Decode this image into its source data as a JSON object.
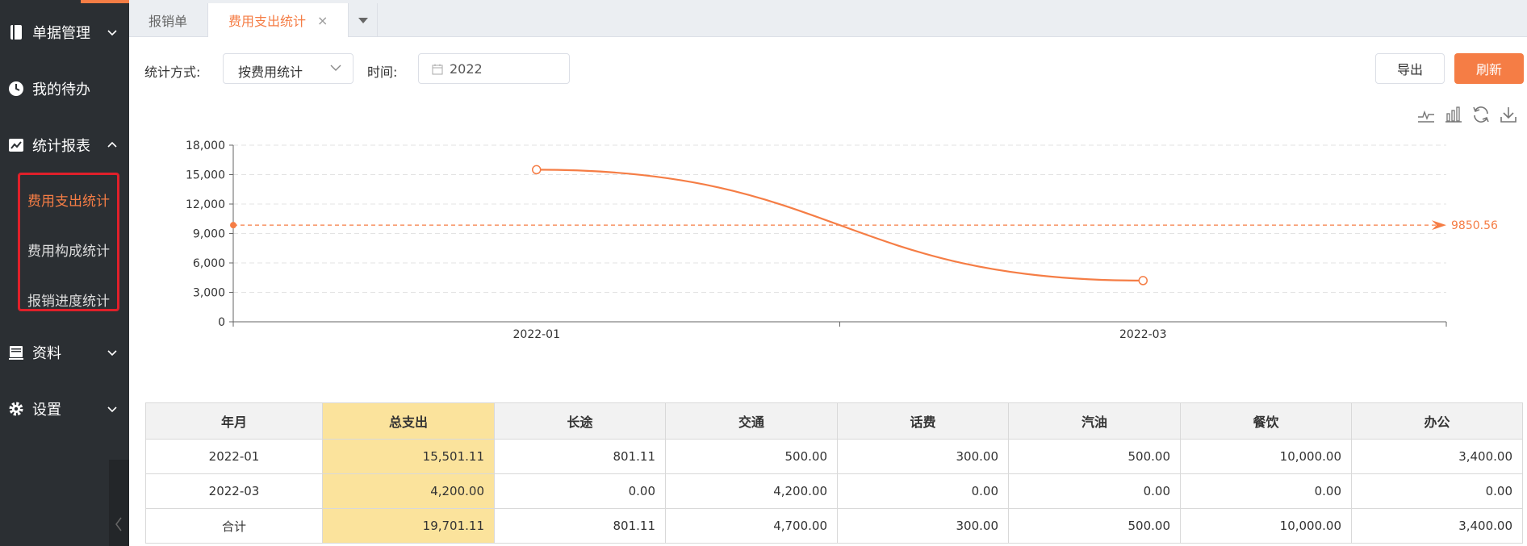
{
  "sidebar": {
    "menu": [
      {
        "label": "单据管理",
        "icon": "book-icon",
        "expanded": false
      },
      {
        "label": "我的待办",
        "icon": "clock-icon"
      },
      {
        "label": "统计报表",
        "icon": "chart-icon",
        "expanded": true
      },
      {
        "label": "资料",
        "icon": "stack-icon",
        "expanded": false
      },
      {
        "label": "设置",
        "icon": "gear-icon",
        "expanded": false
      }
    ],
    "submenu": [
      {
        "label": "费用支出统计",
        "active": true
      },
      {
        "label": "费用构成统计"
      },
      {
        "label": "报销进度统计"
      }
    ]
  },
  "tabs": [
    {
      "label": "报销单"
    },
    {
      "label": "费用支出统计",
      "active": true,
      "close": "×"
    }
  ],
  "filters": {
    "method_label": "统计方式:",
    "method_value": "按费用统计",
    "time_label": "时间:",
    "time_value": "2022"
  },
  "buttons": {
    "export": "导出",
    "refresh": "刷新"
  },
  "colors": {
    "accent": "#f57d45",
    "highlight": "#fbe39c",
    "sidebar": "#2b2f33"
  },
  "chart_data": {
    "type": "line",
    "x": [
      "2022-01",
      "2022-03"
    ],
    "series": [
      {
        "values": [
          15501.11,
          4200.0
        ]
      }
    ],
    "yticks": [
      "0",
      "3,000",
      "6,000",
      "9,000",
      "12,000",
      "15,000",
      "18,000"
    ],
    "ylim": [
      0,
      18000
    ],
    "average_line": {
      "value": 9850.56,
      "label": "9850.56"
    },
    "grid": true
  },
  "table": {
    "headers": [
      "年月",
      "总支出",
      "长途",
      "交通",
      "话费",
      "汽油",
      "餐饮",
      "办公"
    ],
    "rows": [
      [
        "2022-01",
        "15,501.11",
        "801.11",
        "500.00",
        "300.00",
        "500.00",
        "10,000.00",
        "3,400.00"
      ],
      [
        "2022-03",
        "4,200.00",
        "0.00",
        "4,200.00",
        "0.00",
        "0.00",
        "0.00",
        "0.00"
      ],
      [
        "合计",
        "19,701.11",
        "801.11",
        "4,700.00",
        "300.00",
        "500.00",
        "10,000.00",
        "3,400.00"
      ]
    ]
  }
}
